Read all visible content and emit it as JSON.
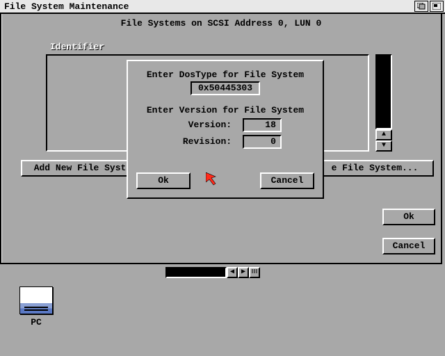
{
  "screen": {
    "title": "File System Maintenance"
  },
  "main": {
    "header": "File Systems on  SCSI  Address 0, LUN 0",
    "identifier_label": "Identifier",
    "buttons": {
      "add": "Add New File Syst",
      "update": "e File System...",
      "ok": "Ok",
      "cancel": "Cancel"
    }
  },
  "dialog": {
    "dostype_label": "Enter DosType for File System",
    "dostype_value": "0x50445303",
    "version_label": "Enter Version for File System",
    "version_field_label": "Version:",
    "version_value": "18",
    "revision_field_label": "Revision:",
    "revision_value": "0",
    "ok": "Ok",
    "cancel": "Cancel"
  },
  "desktop": {
    "disk_label": "PC"
  }
}
